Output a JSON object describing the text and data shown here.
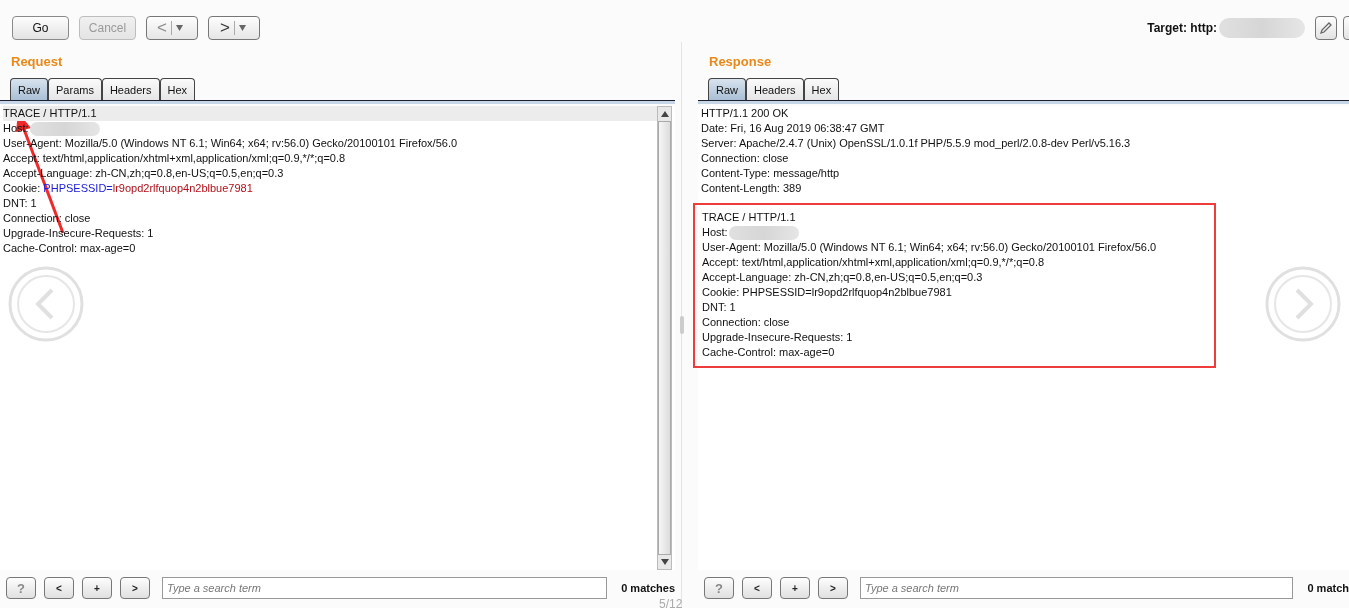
{
  "toolbar": {
    "buttons": [
      {
        "label": "Go",
        "disabled": false
      },
      {
        "label": "Cancel",
        "disabled": true
      }
    ],
    "history": [
      {
        "kind": "back",
        "label": "<",
        "disabled": true
      },
      {
        "kind": "forward",
        "label": ">",
        "disabled": false
      }
    ],
    "target_label": "Target: http:"
  },
  "request": {
    "title": "Request",
    "tabs": [
      {
        "label": "Raw",
        "selected": true
      },
      {
        "label": "Params",
        "selected": false
      },
      {
        "label": "Headers",
        "selected": false
      },
      {
        "label": "Hex",
        "selected": false
      }
    ],
    "lines": [
      {
        "highlighted": true,
        "parts": [
          {
            "text": "TRACE / HTTP/1.1",
            "kind": "plain"
          }
        ]
      },
      {
        "highlighted": false,
        "redacted": true,
        "parts": [
          {
            "text": "Host:",
            "kind": "plain"
          }
        ]
      },
      {
        "highlighted": false,
        "parts": [
          {
            "text": "User-Agent: Mozilla/5.0 (Windows NT 6.1; Win64; x64; rv:56.0) Gecko/20100101 Firefox/56.0",
            "kind": "plain"
          }
        ]
      },
      {
        "highlighted": false,
        "parts": [
          {
            "text": "Accept: text/html,application/xhtml+xml,application/xml;q=0.9,*/*;q=0.8",
            "kind": "plain"
          }
        ]
      },
      {
        "highlighted": false,
        "parts": [
          {
            "text": "Accept-Language: zh-CN,zh;q=0.8,en-US;q=0.5,en;q=0.3",
            "kind": "plain"
          }
        ]
      },
      {
        "highlighted": false,
        "parts": [
          {
            "text": "Cookie: ",
            "kind": "plain"
          },
          {
            "text": "PHPSESSID=",
            "kind": "param-name"
          },
          {
            "text": "lr9opd2rlfquop4n2blbue7981",
            "kind": "param-value"
          }
        ]
      },
      {
        "highlighted": false,
        "parts": [
          {
            "text": "DNT: 1",
            "kind": "plain"
          }
        ]
      },
      {
        "highlighted": false,
        "parts": [
          {
            "text": "Connection: close",
            "kind": "plain"
          }
        ]
      },
      {
        "highlighted": false,
        "parts": [
          {
            "text": "Upgrade-Insecure-Requests: 1",
            "kind": "plain"
          }
        ]
      },
      {
        "highlighted": false,
        "parts": [
          {
            "text": "Cache-Control: max-age=0",
            "kind": "plain"
          }
        ]
      }
    ],
    "search": {
      "buttons": [
        "?",
        "<",
        "+",
        ">"
      ],
      "placeholder": "Type a search term"
    },
    "match_count": "0 matches"
  },
  "response": {
    "title": "Response",
    "tabs": [
      {
        "label": "Raw",
        "selected": true
      },
      {
        "label": "Headers",
        "selected": false
      },
      {
        "label": "Hex",
        "selected": false
      }
    ],
    "header_lines": [
      {
        "text": "HTTP/1.1 200 OK"
      },
      {
        "text": "Date: Fri, 16 Aug 2019 06:38:47 GMT"
      },
      {
        "text": "Server: Apache/2.4.7 (Unix) OpenSSL/1.0.1f PHP/5.5.9 mod_perl/2.0.8-dev Perl/v5.16.3"
      },
      {
        "text": "Connection: close"
      },
      {
        "text": "Content-Type: message/http"
      },
      {
        "text": "Content-Length: 389"
      }
    ],
    "body_framed": true,
    "body_lines": [
      {
        "text": "TRACE / HTTP/1.1"
      },
      {
        "text": "Host:",
        "redacted": true
      },
      {
        "text": "User-Agent: Mozilla/5.0 (Windows NT 6.1; Win64; x64; rv:56.0) Gecko/20100101 Firefox/56.0"
      },
      {
        "text": "Accept: text/html,application/xhtml+xml,application/xml;q=0.9,*/*;q=0.8"
      },
      {
        "text": "Accept-Language: zh-CN,zh;q=0.8,en-US;q=0.5,en;q=0.3"
      },
      {
        "text": "Cookie: PHPSESSID=lr9opd2rlfquop4n2blbue7981"
      },
      {
        "text": "DNT: 1"
      },
      {
        "text": "Connection: close"
      },
      {
        "text": "Upgrade-Insecure-Requests: 1"
      },
      {
        "text": "Cache-Control: max-age=0"
      }
    ],
    "search": {
      "buttons": [
        "?",
        "<",
        "+",
        ">"
      ],
      "placeholder": "Type a search term"
    },
    "match_count": "0 match"
  },
  "page_counter": "5/12"
}
